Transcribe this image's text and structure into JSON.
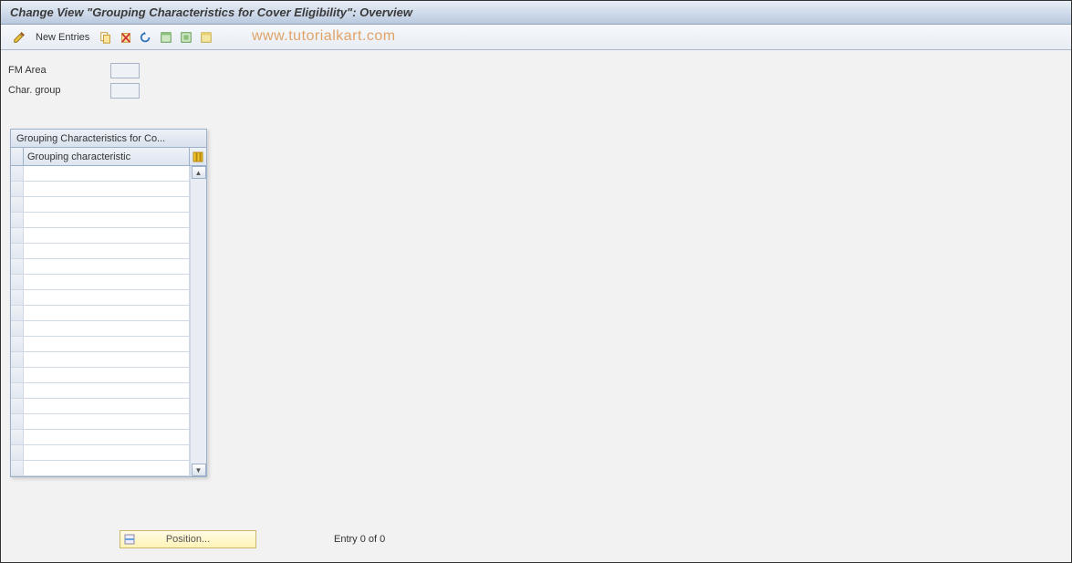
{
  "header": {
    "title": "Change View \"Grouping Characteristics for Cover Eligibility\": Overview"
  },
  "toolbar": {
    "new_entries_label": "New Entries",
    "icons": {
      "pencil": "pencil-icon",
      "copy": "copy-icon",
      "delete": "delete-icon",
      "undo": "undo-icon",
      "select_all": "select-all-icon",
      "select_block": "select-block-icon",
      "deselect_all": "deselect-all-icon"
    }
  },
  "watermark": "www.tutorialkart.com",
  "fields": {
    "fm_area": {
      "label": "FM Area",
      "value": ""
    },
    "char_group": {
      "label": "Char. group",
      "value": ""
    }
  },
  "table": {
    "title": "Grouping Characteristics for Co...",
    "column_header": "Grouping characteristic",
    "rows": [
      "",
      "",
      "",
      "",
      "",
      "",
      "",
      "",
      "",
      "",
      "",
      "",
      "",
      "",
      "",
      "",
      "",
      "",
      "",
      ""
    ]
  },
  "footer": {
    "position_label": "Position...",
    "entry_text": "Entry 0 of 0"
  }
}
